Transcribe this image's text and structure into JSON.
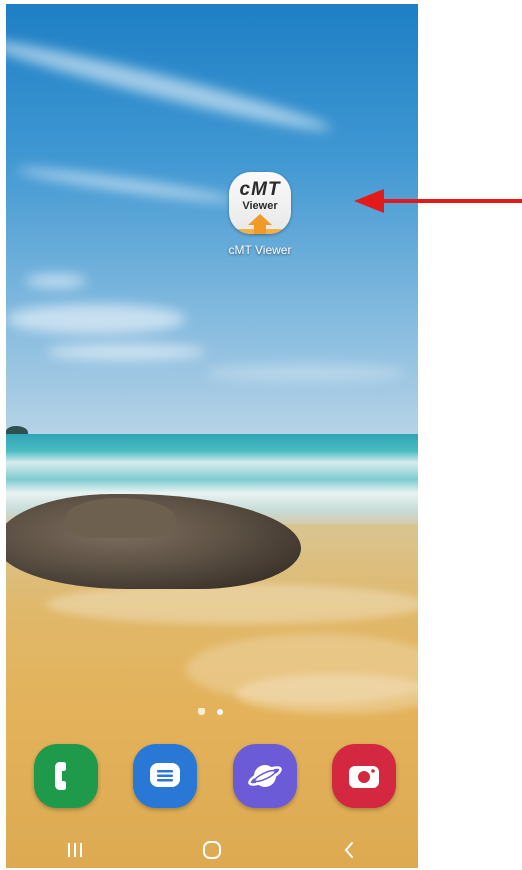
{
  "home_screen": {
    "app_label": "cMT Viewer",
    "app_icon_text_top": "cMT",
    "app_icon_text_bottom": "Viewer",
    "page_indicator": {
      "pages": 2,
      "current": 2
    }
  },
  "dock": {
    "apps": [
      {
        "name": "phone",
        "icon": "phone-icon",
        "color": "#1f9a4b"
      },
      {
        "name": "messages",
        "icon": "message-icon",
        "color": "#2a78d6"
      },
      {
        "name": "internet",
        "icon": "internet-icon",
        "color": "#6b5bd6"
      },
      {
        "name": "camera",
        "icon": "camera-icon",
        "color": "#d3283f"
      }
    ]
  },
  "nav_bar": {
    "buttons": [
      "recents-icon",
      "home-icon",
      "back-icon"
    ]
  },
  "annotation": {
    "arrow_color": "#e21a1a"
  }
}
